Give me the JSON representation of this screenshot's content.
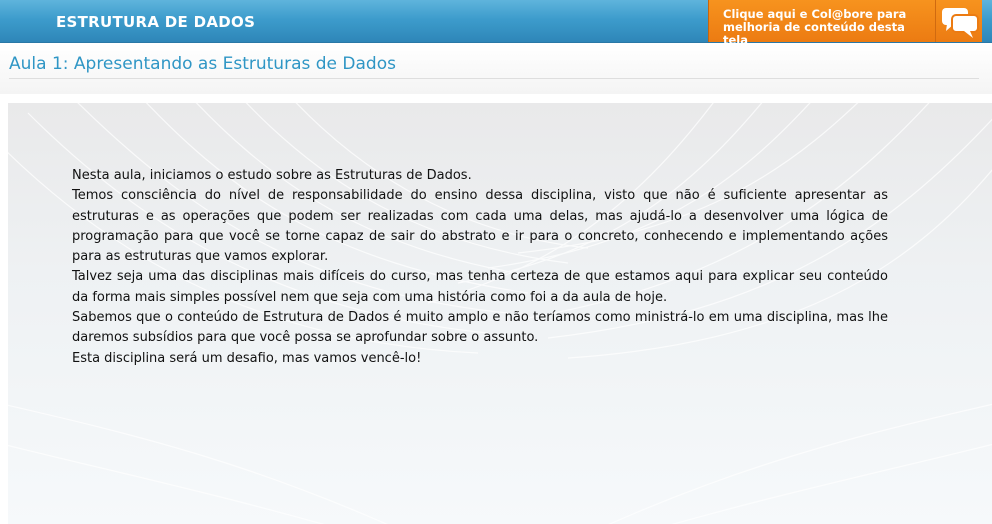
{
  "header": {
    "course_title": "ESTRUTURA DE DADOS",
    "collab_line1": "Clique aqui e Col@bore para",
    "collab_line2": "melhoria de conteúdo desta tela",
    "collab_icon": "chat-bubbles-icon",
    "colors": {
      "bar": "#3d9ccc",
      "collab": "#f08514"
    }
  },
  "lesson": {
    "title": "Aula 1: Apresentando as Estruturas de Dados",
    "title_color": "#2f96c5"
  },
  "content": {
    "paragraphs": [
      "Nesta aula, iniciamos o estudo sobre as Estruturas de Dados.",
      "Temos consciência do nível de responsabilidade do ensino dessa disciplina, visto que não é suficiente apresentar as estruturas e as operações que podem ser realizadas com cada uma delas, mas ajudá-lo a desenvolver uma lógica de programação para que você se torne capaz de sair do abstrato e ir para o concreto, conhecendo e implementando ações para as estruturas que vamos explorar.",
      "Talvez seja uma das disciplinas mais difíceis do curso, mas tenha certeza de que estamos aqui para explicar seu conteúdo da forma mais simples possível nem que seja com uma história como foi a da aula de hoje.",
      "Sabemos que o conteúdo de Estrutura de Dados é muito amplo e não teríamos como ministrá-lo em uma disciplina, mas lhe daremos subsídios para que você possa se aprofundar sobre o assunto.",
      "Esta disciplina será um desafio, mas vamos vencê-lo!"
    ]
  }
}
